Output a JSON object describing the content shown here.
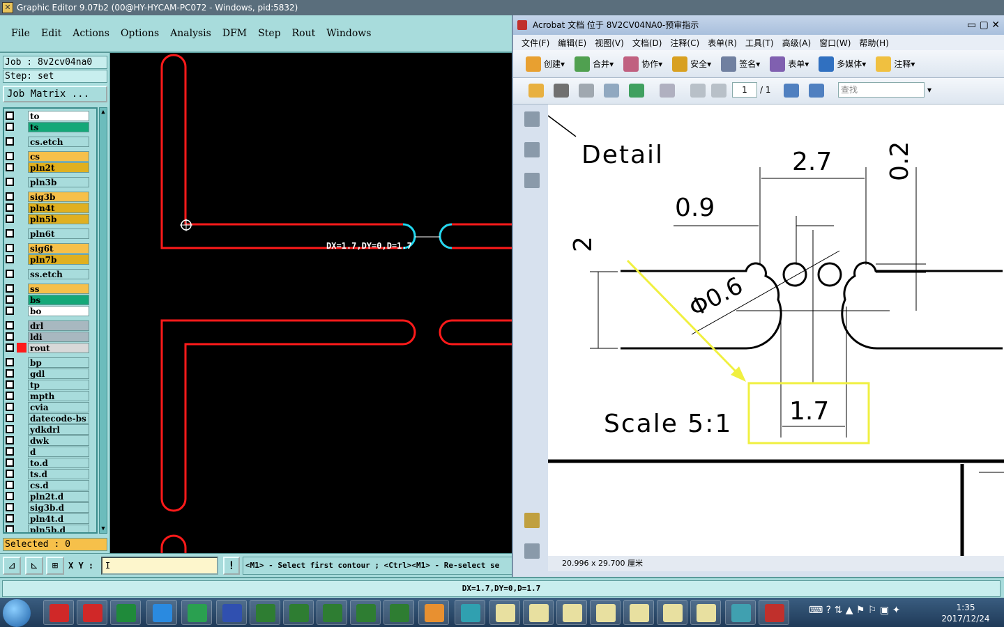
{
  "ge": {
    "title": "Graphic Editor 9.07b2 (00@HY-HYCAM-PC072 - Windows, pid:5832)",
    "menus": [
      "File",
      "Edit",
      "Actions",
      "Options",
      "Analysis",
      "DFM",
      "Step",
      "Rout",
      "Windows"
    ],
    "job_line": "Job : 8v2cv04na0",
    "step_line": "Step: set",
    "job_matrix_label": "Job Matrix ...",
    "layers": [
      {
        "name": "to",
        "color": "#ffffff"
      },
      {
        "name": "ts",
        "color": "#14a878"
      },
      {
        "name": "cs.etch",
        "color": "#a8dcdc"
      },
      {
        "name": "cs",
        "color": "#f6c04a"
      },
      {
        "name": "pln2t",
        "color": "#e0b020"
      },
      {
        "name": "pln3b",
        "color": "#a8dcdc"
      },
      {
        "name": "sig3b",
        "color": "#f6c04a"
      },
      {
        "name": "pln4t",
        "color": "#e0b020"
      },
      {
        "name": "pln5b",
        "color": "#e0b020"
      },
      {
        "name": "pln6t",
        "color": "#a8dcdc"
      },
      {
        "name": "sig6t",
        "color": "#f6c04a"
      },
      {
        "name": "pln7b",
        "color": "#e0b020"
      },
      {
        "name": "ss.etch",
        "color": "#a8dcdc"
      },
      {
        "name": "ss",
        "color": "#f6c04a"
      },
      {
        "name": "bs",
        "color": "#14a878"
      },
      {
        "name": "bo",
        "color": "#ffffff"
      },
      {
        "name": "drl",
        "color": "#a8b8c0"
      },
      {
        "name": "ldi",
        "color": "#a8b8c0"
      },
      {
        "name": "rout",
        "color": "#d8d8d8"
      },
      {
        "name": "bp",
        "color": "#a8dcdc"
      },
      {
        "name": "gdl",
        "color": "#a8dcdc"
      },
      {
        "name": "tp",
        "color": "#a8dcdc"
      },
      {
        "name": "mpth",
        "color": "#a8dcdc"
      },
      {
        "name": "cvia",
        "color": "#a8dcdc"
      },
      {
        "name": "datecode-bs",
        "color": "#a8dcdc"
      },
      {
        "name": "ydkdrl",
        "color": "#a8dcdc"
      },
      {
        "name": "dwk",
        "color": "#a8dcdc"
      },
      {
        "name": "d",
        "color": "#a8dcdc"
      },
      {
        "name": "to.d",
        "color": "#a8dcdc"
      },
      {
        "name": "ts.d",
        "color": "#a8dcdc"
      },
      {
        "name": "cs.d",
        "color": "#a8dcdc"
      },
      {
        "name": "pln2t.d",
        "color": "#a8dcdc"
      },
      {
        "name": "sig3b.d",
        "color": "#a8dcdc"
      },
      {
        "name": "pln4t.d",
        "color": "#a8dcdc"
      },
      {
        "name": "pln5b.d",
        "color": "#a8dcdc"
      }
    ],
    "selected_line": "Selected : 0",
    "canvas_measure": "DX=1.7,DY=0,D=1.7",
    "xy_label": "X Y :",
    "xy_value": "I",
    "warn_label": "!",
    "prompt": "<M1> - Select first contour ; <Ctrl><M1> - Re-select se",
    "status_bottom": "DX=1.7,DY=0,D=1.7"
  },
  "acrobat": {
    "title": "Acrobat 文档 位于 8V2CV04NA0-预审指示",
    "menus": [
      "文件(F)",
      "编辑(E)",
      "视图(V)",
      "文档(D)",
      "注释(C)",
      "表单(R)",
      "工具(T)",
      "高级(A)",
      "窗口(W)",
      "帮助(H)"
    ],
    "toolbar": [
      "创建",
      "合并",
      "协作",
      "安全",
      "签名",
      "表单",
      "多媒体",
      "注释"
    ],
    "page_current": "1",
    "page_total": "/ 1",
    "find_placeholder": "查找",
    "doc_detail": "Detail",
    "doc_scale": "Scale  5:1",
    "dim_27": "2.7",
    "dim_09": "0.9",
    "dim_02": "0.2",
    "dim_2": "2",
    "dim_phi": "Φ0.6",
    "dim_17": "1.7",
    "page_size": "20.996 x 29.700 厘米"
  },
  "taskbar": {
    "time": "1:35",
    "date": "2017/12/24"
  },
  "colors": {
    "route_red": "#ff1a1a",
    "cyan": "#20d8f0",
    "highlight_yellow": "#f0f040"
  }
}
